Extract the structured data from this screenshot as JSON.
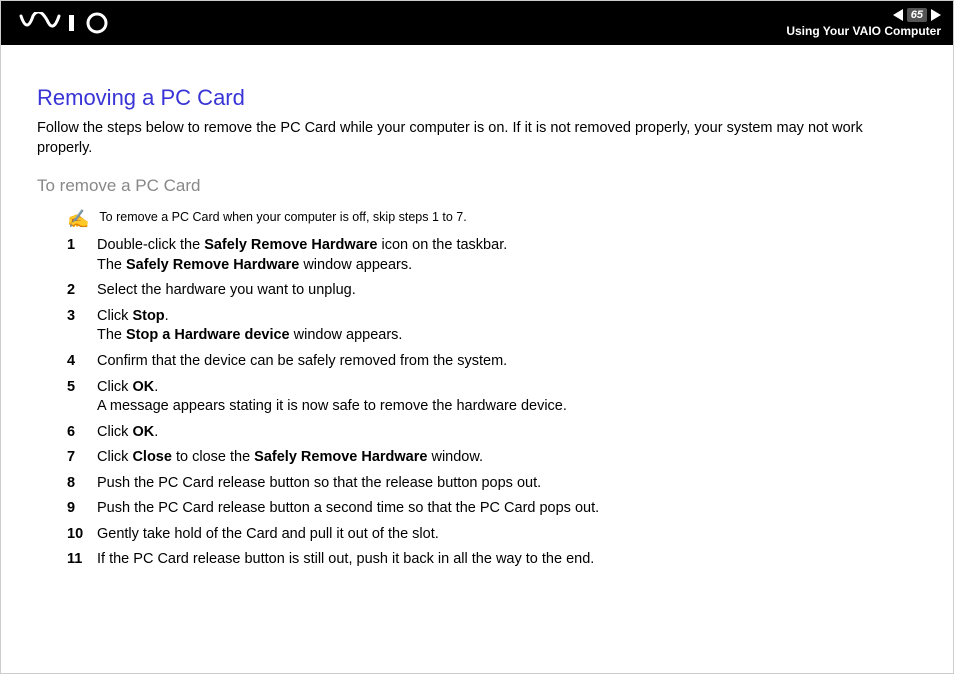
{
  "header": {
    "page_number": "65",
    "section": "Using Your VAIO Computer"
  },
  "title": "Removing a PC Card",
  "intro": "Follow the steps below to remove the PC Card while your computer is on. If it is not removed properly, your system may not work properly.",
  "subtitle": "To remove a PC Card",
  "note": "To remove a PC Card when your computer is off, skip steps 1 to 7.",
  "steps": [
    {
      "n": "1",
      "html": "Double-click the <b>Safely Remove Hardware</b> icon on the taskbar.<br>The <b>Safely Remove Hardware</b> window appears."
    },
    {
      "n": "2",
      "html": "Select the hardware you want to unplug."
    },
    {
      "n": "3",
      "html": "Click <b>Stop</b>.<br>The <b>Stop a Hardware device</b> window appears."
    },
    {
      "n": "4",
      "html": "Confirm that the device can be safely removed from the system."
    },
    {
      "n": "5",
      "html": "Click <b>OK</b>.<br>A message appears stating it is now safe to remove the hardware device."
    },
    {
      "n": "6",
      "html": "Click <b>OK</b>."
    },
    {
      "n": "7",
      "html": "Click <b>Close</b> to close the <b>Safely Remove Hardware</b> window."
    },
    {
      "n": "8",
      "html": "Push the PC Card release button so that the release button pops out."
    },
    {
      "n": "9",
      "html": "Push the PC Card release button a second time so that the PC Card pops out."
    },
    {
      "n": "10",
      "html": "Gently take hold of the Card and pull it out of the slot."
    },
    {
      "n": "11",
      "html": "If the PC Card release button is still out, push it back in all the way to the end."
    }
  ]
}
